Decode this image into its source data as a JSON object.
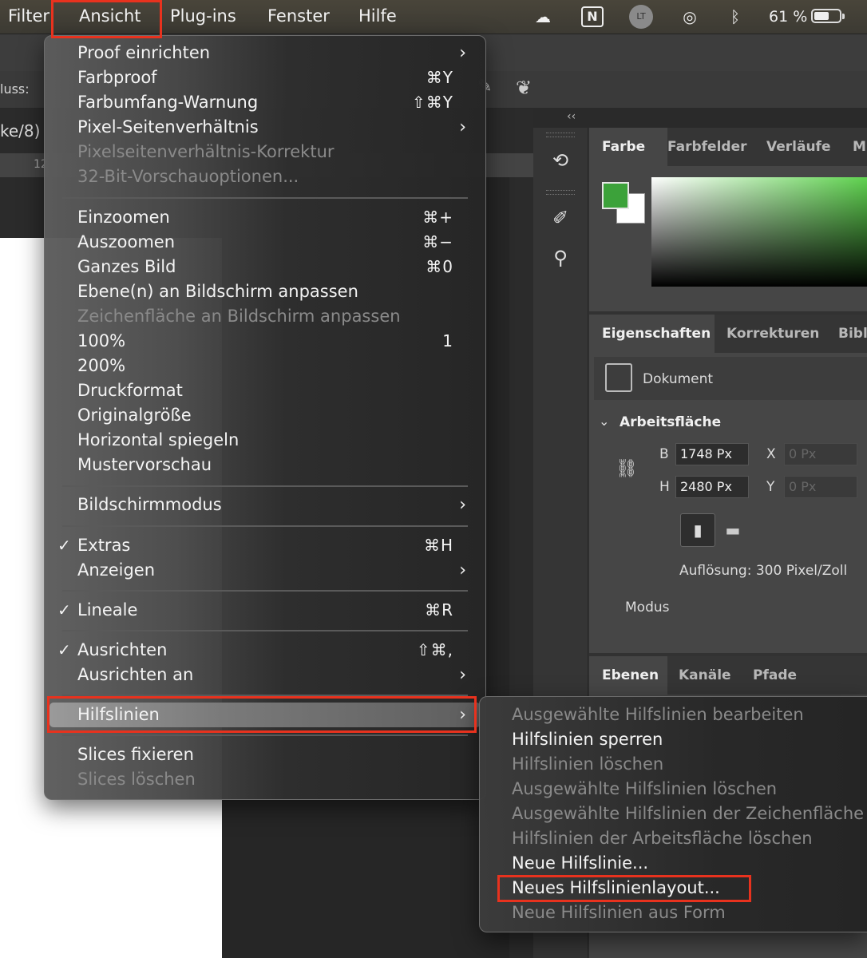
{
  "menubar": {
    "items": [
      "Filter",
      "Ansicht",
      "Plug-ins",
      "Fenster",
      "Hilfe"
    ],
    "battery_percent": "61 %",
    "battery_level": 0.61,
    "highlight_color": "#e8321e"
  },
  "ps": {
    "options_label": "luss:",
    "doc_tab": "ke/8)",
    "ruler_num": "12",
    "collapse": "‹‹",
    "color_tabs": [
      "Farbe",
      "Farbfelder",
      "Verläufe",
      "Mu"
    ],
    "props_tabs": [
      "Eigenschaften",
      "Korrekturen",
      "Bibli"
    ],
    "doc_label": "Dokument",
    "section_title": "Arbeitsfläche",
    "b_label": "B",
    "b_value": "1748 Px",
    "h_label": "H",
    "h_value": "2480 Px",
    "x_label": "X",
    "x_value": "0 Px",
    "y_label": "Y",
    "y_value": "0 Px",
    "resolution": "Auflösung: 300 Pixel/Zoll",
    "mode_label": "Modus",
    "layer_tabs": [
      "Ebenen",
      "Kanäle",
      "Pfade"
    ],
    "fg_color": "#3ca23a",
    "bg_color": "#ffffff"
  },
  "menu": {
    "proof": "Proof einrichten",
    "farbproof": "Farbproof",
    "farbproof_sc": "⌘Y",
    "farbumfang": "Farbumfang-Warnung",
    "farbumfang_sc": "⇧⌘Y",
    "pixel_seiten": "Pixel-Seitenverhältnis",
    "pixel_korrektur": "Pixelseitenverhältnis-Korrektur",
    "bit32": "32-Bit-Vorschauoptionen...",
    "einzoomen": "Einzoomen",
    "einzoomen_sc": "⌘+",
    "auszoomen": "Auszoomen",
    "auszoomen_sc": "⌘−",
    "ganzes_bild": "Ganzes Bild",
    "ganzes_bild_sc": "⌘0",
    "ebenen_anpassen": "Ebene(n) an Bildschirm anpassen",
    "zeichenflaeche": "Zeichenfläche an Bildschirm anpassen",
    "p100": "100%",
    "p100_sc": "1",
    "p200": "200%",
    "druckformat": "Druckformat",
    "originalgroesse": "Originalgröße",
    "horizontal": "Horizontal spiegeln",
    "mustervorschau": "Mustervorschau",
    "bildschirmmodus": "Bildschirmmodus",
    "extras": "Extras",
    "extras_sc": "⌘H",
    "anzeigen": "Anzeigen",
    "lineale": "Lineale",
    "lineale_sc": "⌘R",
    "ausrichten": "Ausrichten",
    "ausrichten_sc": "⇧⌘,",
    "ausrichten_an": "Ausrichten an",
    "hilfslinien": "Hilfslinien",
    "slices_fixieren": "Slices fixieren",
    "slices_loeschen": "Slices löschen",
    "check": "✓",
    "arrow": "›"
  },
  "submenu": {
    "items": [
      "Ausgewählte Hilfslinien bearbeiten",
      "Hilfslinien sperren",
      "Hilfslinien löschen",
      "Ausgewählte Hilfslinien löschen",
      "Ausgewählte Hilfslinien der Zeichenfläche löschen",
      "Hilfslinien der Arbeitsfläche löschen",
      "Neue Hilfslinie...",
      "Neues Hilfslinienlayout...",
      "Neue Hilfslinien aus Form"
    ]
  }
}
